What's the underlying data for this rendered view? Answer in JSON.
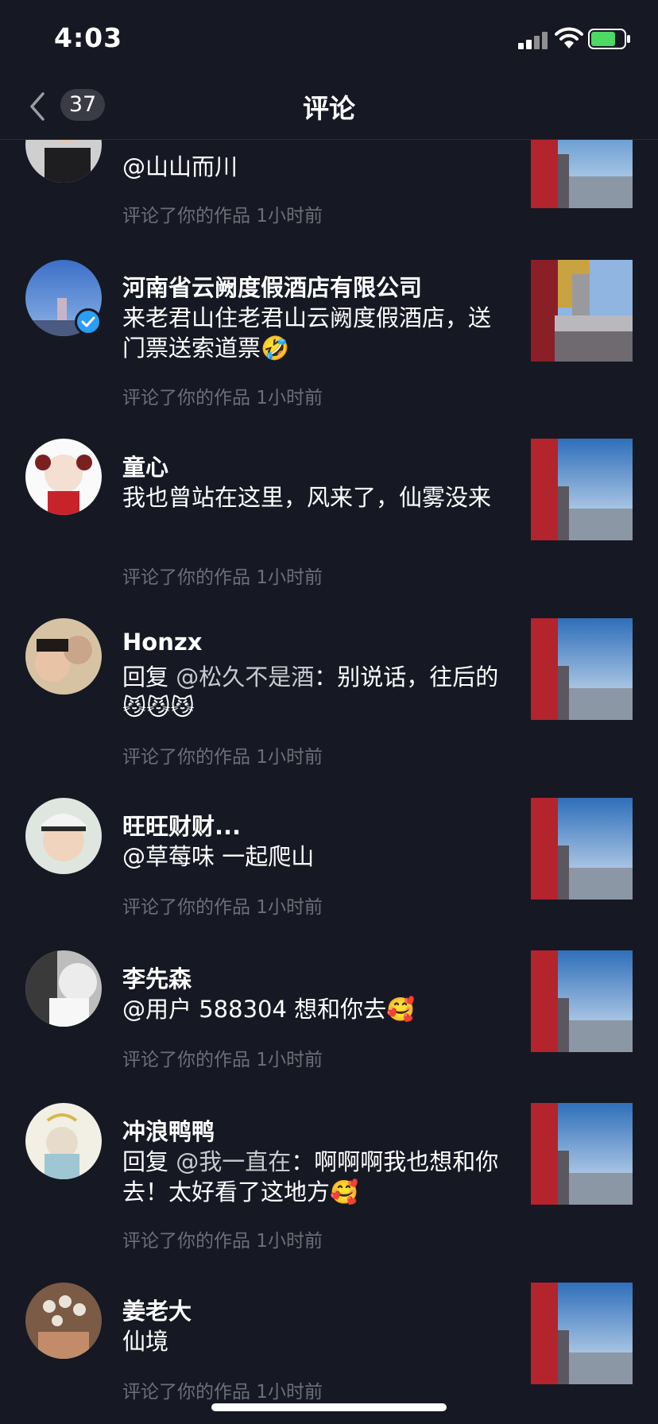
{
  "status_bar": {
    "time": "4:03"
  },
  "header": {
    "back_count": "37",
    "title": "评论"
  },
  "notifications": [
    {
      "username": "",
      "reply_prefix": "",
      "mention": "",
      "text": "@山山而川",
      "meta": "评论了你的作品  1小时前",
      "verified": false
    },
    {
      "username": "河南省云阙度假酒店有限公司",
      "reply_prefix": "",
      "mention": "",
      "text": "来老君山住老君山云阙度假酒店，送门票送索道票🤣",
      "meta": "评论了你的作品  1小时前",
      "verified": true
    },
    {
      "username": "童心",
      "reply_prefix": "",
      "mention": "",
      "text": "我也曾站在这里，风来了，仙雾没来",
      "meta": "评论了你的作品  1小时前",
      "verified": false
    },
    {
      "username": "Honzx",
      "reply_prefix": "回复 ",
      "mention": "@松久不是酒",
      "text": "：别说话，往后的 😼😼😼",
      "meta": "评论了你的作品  1小时前",
      "verified": false
    },
    {
      "username": "旺旺财财...",
      "reply_prefix": "",
      "mention": "",
      "text": "@草莓味 一起爬山",
      "meta": "评论了你的作品  1小时前",
      "verified": false
    },
    {
      "username": "李先森",
      "reply_prefix": "",
      "mention": "",
      "text": "@用户 588304 想和你去🥰",
      "meta": "评论了你的作品  1小时前",
      "verified": false
    },
    {
      "username": "冲浪鸭鸭",
      "reply_prefix": "回复 ",
      "mention": "@我一直在",
      "text": "：啊啊啊我也想和你去！太好看了这地方🥰",
      "meta": "评论了你的作品  1小时前",
      "verified": false
    },
    {
      "username": "姜老大",
      "reply_prefix": "",
      "mention": "",
      "text": "仙境",
      "meta": "评论了你的作品  1小时前",
      "verified": false
    }
  ],
  "colors": {
    "background": "#161823",
    "meta": "#6c6e78",
    "verified": "#2a9df4",
    "battery": "#4cd964"
  }
}
